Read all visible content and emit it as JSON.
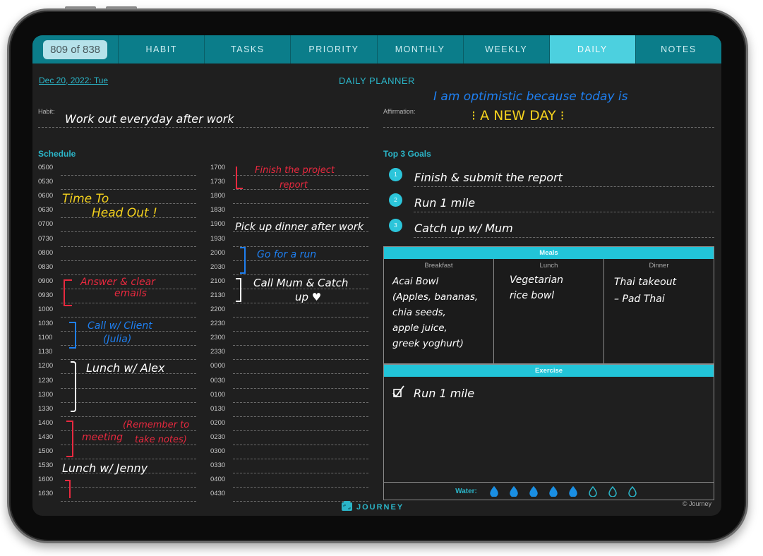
{
  "tabs": {
    "page_counter": "809 of 838",
    "items": [
      {
        "label": "HABIT",
        "active": false
      },
      {
        "label": "TASKS",
        "active": false
      },
      {
        "label": "PRIORITY",
        "active": false
      },
      {
        "label": "MONTHLY",
        "active": false
      },
      {
        "label": "WEEKLY",
        "active": false
      },
      {
        "label": "DAILY",
        "active": true
      },
      {
        "label": "NOTES",
        "active": false
      }
    ]
  },
  "header": {
    "date": "Dec 20, 2022: Tue",
    "title": "DAILY PLANNER"
  },
  "habit": {
    "label": "Habit:",
    "value": "Work out everyday after work"
  },
  "affirmation": {
    "label": "Affirmation:",
    "line1": "I am optimistic because today is",
    "line2": "A NEW DAY"
  },
  "schedule": {
    "heading": "Schedule",
    "left_times": [
      "0500",
      "0530",
      "0600",
      "0630",
      "0700",
      "0730",
      "0800",
      "0830",
      "0900",
      "0930",
      "1000",
      "1030",
      "1100",
      "1130",
      "1200",
      "1230",
      "1300",
      "1330",
      "1400",
      "1430",
      "1500",
      "1530",
      "1600",
      "1630"
    ],
    "right_times": [
      "1700",
      "1730",
      "1800",
      "1830",
      "1900",
      "1930",
      "2000",
      "2030",
      "2100",
      "2130",
      "2200",
      "2230",
      "2300",
      "2330",
      "0000",
      "0030",
      "0100",
      "0130",
      "0200",
      "0230",
      "0300",
      "0330",
      "0400",
      "0430"
    ],
    "entries": {
      "head_out_1": "Time To",
      "head_out_2": "Head Out !",
      "emails_1": "Answer & clear",
      "emails_2": "emails",
      "client_1": "Call w/ Client",
      "client_2": "(Julia)",
      "lunch_alex": "Lunch w/ Alex",
      "meeting": "meeting",
      "meeting_note_1": "(Remember to",
      "meeting_note_2": "take notes)",
      "lunch_jenny": "Lunch w/ Jenny",
      "project_1": "Finish the project",
      "project_2": "report",
      "pickup": "Pick up dinner after work",
      "run": "Go for a run",
      "mum_1": "Call Mum & Catch",
      "mum_2": "up ♥"
    }
  },
  "goals": {
    "heading": "Top 3 Goals",
    "items": [
      {
        "num": "1",
        "text": "Finish & submit the report"
      },
      {
        "num": "2",
        "text": "Run 1 mile"
      },
      {
        "num": "3",
        "text": "Catch up w/ Mum"
      }
    ]
  },
  "meals": {
    "heading": "Meals",
    "breakfast": {
      "label": "Breakfast",
      "text": "Acai Bowl\n(Apples, bananas,\nchia seeds,\napple juice,\ngreek yoghurt)"
    },
    "lunch": {
      "label": "Lunch",
      "text": "Vegetarian\nrice bowl"
    },
    "dinner": {
      "label": "Dinner",
      "text": "Thai takeout\n– Pad Thai"
    }
  },
  "exercise": {
    "heading": "Exercise",
    "items": [
      {
        "text": "Run 1 mile",
        "checked": true
      }
    ]
  },
  "water": {
    "label": "Water:",
    "filled": 5,
    "total": 8
  },
  "footer": {
    "brand": "JOURNEY",
    "copyright": "© Journey"
  },
  "colors": {
    "accent": "#2bb5c8",
    "tab": "#0b7d8a",
    "tab_active": "#4cd0df",
    "ink_white": "#ffffff",
    "ink_red": "#e8293f",
    "ink_blue": "#1f7ff0",
    "ink_yellow": "#f5d21e",
    "water_drop": "#1a8fe3"
  }
}
